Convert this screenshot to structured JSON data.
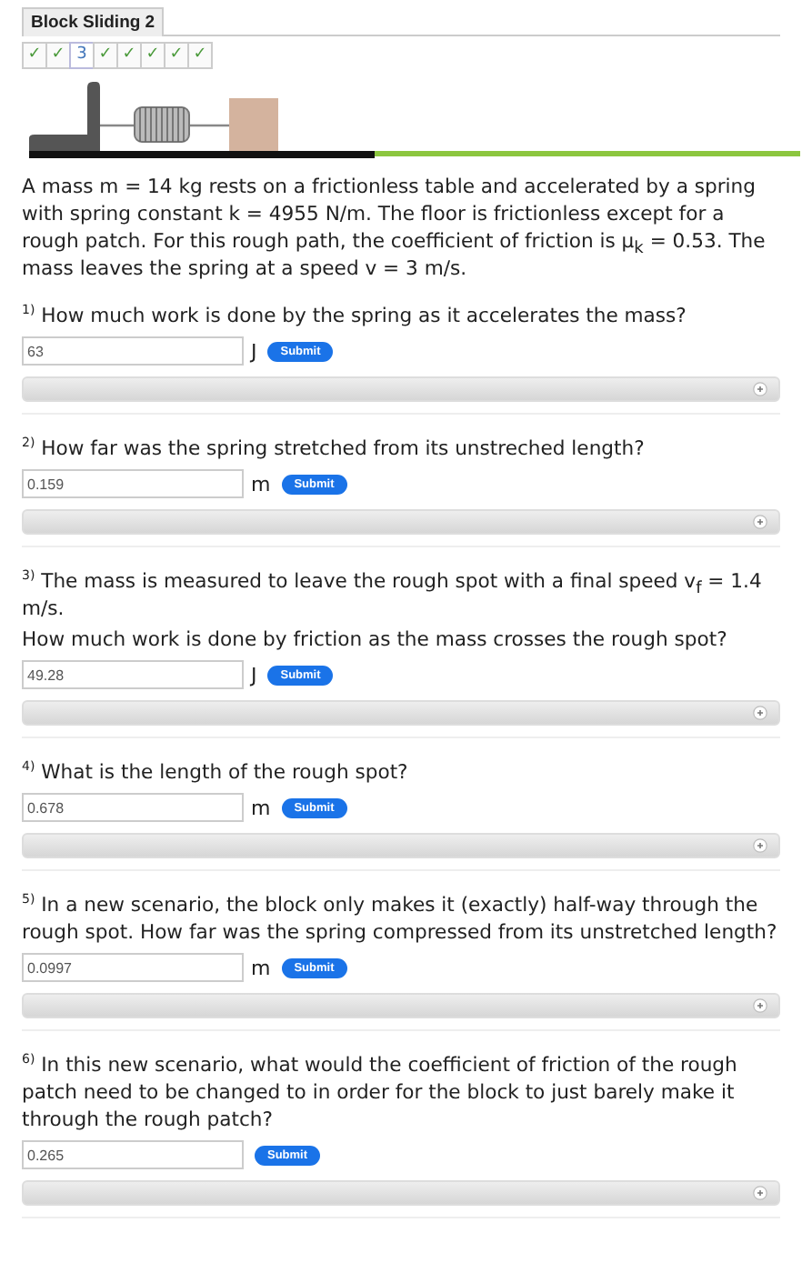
{
  "title": "Block Sliding 2",
  "progress": [
    {
      "label": "✓",
      "selected": false
    },
    {
      "label": "✓",
      "selected": false
    },
    {
      "label": "3",
      "selected": true
    },
    {
      "label": "✓",
      "selected": false
    },
    {
      "label": "✓",
      "selected": false
    },
    {
      "label": "✓",
      "selected": false
    },
    {
      "label": "✓",
      "selected": false
    },
    {
      "label": "✓",
      "selected": false
    }
  ],
  "problem": "A mass m = 14 kg rests on a frictionless table and accelerated by a spring with spring constant k = 4955 N/m. The floor is frictionless except for a rough patch. For this rough path, the coefficient of friction is μ$_{k}$ = 0.53. The mass leaves the spring at a speed v = 3 m/s.",
  "questions": [
    {
      "number": "1)",
      "text": [
        "How much work is done by the spring as it accelerates the mass?"
      ],
      "value": "63",
      "unit": "J",
      "button": "Submit"
    },
    {
      "number": "2)",
      "text": [
        "How far was the spring stretched from its unstreched length?"
      ],
      "value": "0.159",
      "unit": "m",
      "button": "Submit"
    },
    {
      "number": "3)",
      "text": [
        "The mass is measured to leave the rough spot with a final speed v$_{f}$ = 1.4 m/s.",
        "How much work is done by friction as the mass crosses the rough spot?"
      ],
      "value": "49.28",
      "unit": "J",
      "button": "Submit"
    },
    {
      "number": "4)",
      "text": [
        "What is the length of the rough spot?"
      ],
      "value": "0.678",
      "unit": "m",
      "button": "Submit"
    },
    {
      "number": "5)",
      "text": [
        "In a new scenario, the block only makes it (exactly) half-way through the rough spot. How far was the spring compressed from its unstretched length?"
      ],
      "value": "0.0997",
      "unit": "m",
      "button": "Submit"
    },
    {
      "number": "6)",
      "text": [
        "In this new scenario, what would the coefficient of friction of the rough patch need to be changed to in order for the block to just barely make it through the rough patch?"
      ],
      "value": "0.265",
      "button": "Submit"
    }
  ]
}
